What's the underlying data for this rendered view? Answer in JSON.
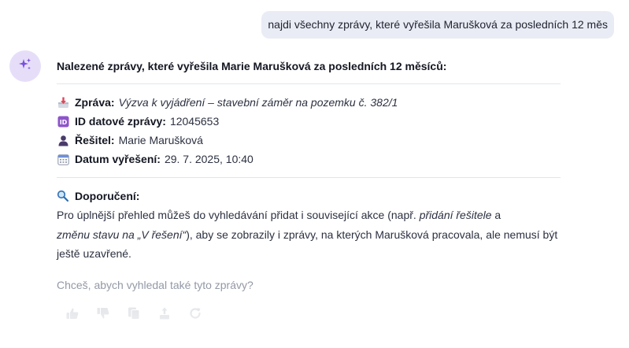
{
  "user_message": {
    "text": "najdi všechny zprávy, které vyřešila Marušková za posledních 12 měs"
  },
  "assistant": {
    "avatar_icon": "sparkles-icon",
    "heading": "Nalezené zprávy, které vyřešila Marie Marušková za posledních 12 měsíců:",
    "fields": [
      {
        "icon": "inbox-tray-icon",
        "label": "Zpráva:",
        "value": "Výzva k vyjádření – stavební záměr na pozemku č. 382/1"
      },
      {
        "icon": "id-badge-icon",
        "label": "ID datové zprávy:",
        "value": "12045653"
      },
      {
        "icon": "person-icon",
        "label": "Řešitel:",
        "value": "Marie Marušková"
      },
      {
        "icon": "calendar-icon",
        "label": "Datum vyřešení:",
        "value": "29. 7. 2025, 10:40"
      }
    ],
    "recommendation": {
      "icon": "magnifier-icon",
      "title": "Doporučení:",
      "text_1": "Pro úplnější přehled můžeš do vyhledávání přidat i související akce (např. ",
      "em_1": "přidání řešitele",
      "text_2": " a ",
      "em_2": "změnu stavu na „V řešení“",
      "text_3": "), aby se zobrazily i zprávy, na kterých Marušková pracovala, ale nemusí být ještě uzavřené."
    },
    "question": "Chceš, abych vyhledal také tyto zprávy?"
  },
  "actions": [
    {
      "name": "thumbs-up-icon"
    },
    {
      "name": "thumbs-down-icon"
    },
    {
      "name": "copy-icon"
    },
    {
      "name": "export-icon"
    },
    {
      "name": "regenerate-icon"
    }
  ],
  "colors": {
    "user_bubble": "#e9ecf4",
    "avatar_bg": "#e6def9",
    "accent": "#7b4fe0",
    "muted_text": "#9096a3"
  }
}
